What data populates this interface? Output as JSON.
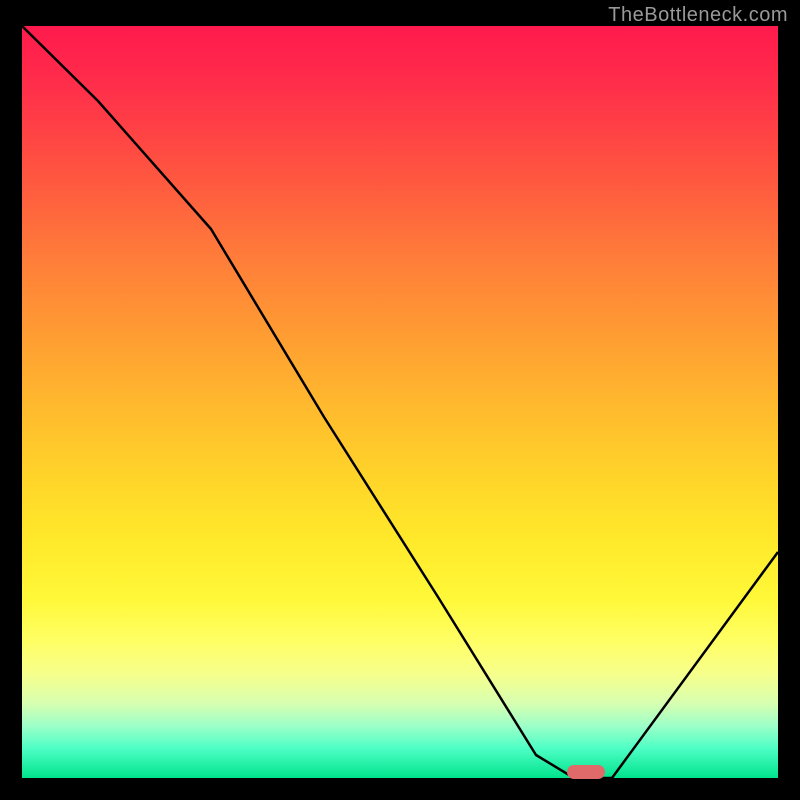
{
  "watermark": "TheBottleneck.com",
  "chart_data": {
    "type": "line",
    "title": "",
    "xlabel": "",
    "ylabel": "",
    "xlim": [
      0,
      100
    ],
    "ylim": [
      0,
      100
    ],
    "grid": false,
    "series": [
      {
        "name": "curve",
        "x": [
          0,
          10,
          25,
          40,
          55,
          68,
          73,
          78,
          100
        ],
        "y": [
          100,
          90,
          73,
          48,
          24,
          3,
          0,
          0,
          30
        ]
      }
    ],
    "annotations": [
      {
        "name": "marker",
        "x_range": [
          73,
          78
        ],
        "y": 0
      }
    ],
    "background": "vertical-gradient-red-to-green"
  }
}
